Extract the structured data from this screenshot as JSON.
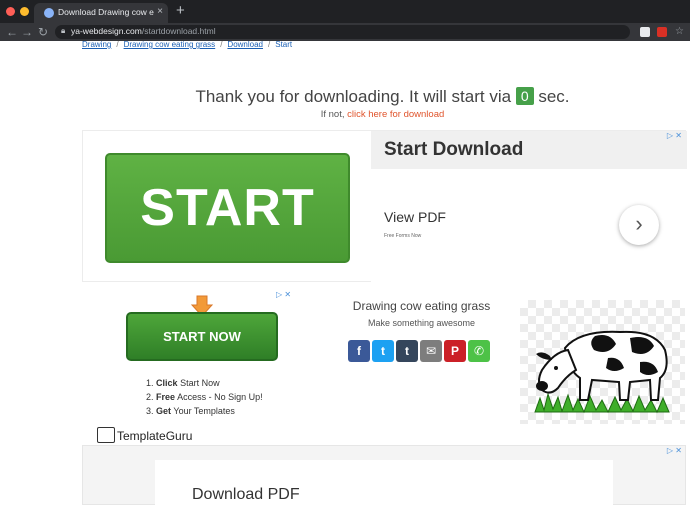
{
  "browser": {
    "tab_title": "Download Drawing cow eating",
    "tab_close": "×",
    "new_tab": "+",
    "url_host": "ya-webdesign.com",
    "url_path": "/startdownload.html",
    "back": "←",
    "forward": "→",
    "reload": "↻"
  },
  "breadcrumb": {
    "items": [
      "Drawing",
      "Drawing cow eating grass",
      "Download"
    ],
    "current": "Start",
    "separator": "/"
  },
  "download": {
    "message_prefix": "Thank you for downloading. It will start via",
    "countdown": "0",
    "message_suffix": "sec.",
    "fallback_prefix": "If not,",
    "fallback_link": "click here for download"
  },
  "ad_top": {
    "button": "START",
    "title": "Start Download",
    "view": "View PDF",
    "small": "Free Forms Now",
    "next": "›"
  },
  "ad_left": {
    "button": "START NOW",
    "steps": [
      {
        "num": "1.",
        "bold": "Click",
        "rest": "Start Now"
      },
      {
        "num": "2.",
        "bold": "Free",
        "rest": "Access - No Sign Up!"
      },
      {
        "num": "3.",
        "bold": "Get",
        "rest": "Your Templates"
      }
    ],
    "brand": "TemplateGuru"
  },
  "share": {
    "title": "Drawing cow eating grass",
    "subtitle": "Make something awesome",
    "buttons": [
      {
        "name": "facebook",
        "glyph": "f",
        "color": "#3b5998"
      },
      {
        "name": "twitter",
        "glyph": "t",
        "color": "#1da1f2"
      },
      {
        "name": "tumblr",
        "glyph": "t",
        "color": "#35465c"
      },
      {
        "name": "email",
        "glyph": "✉",
        "color": "#7d7d7d"
      },
      {
        "name": "pinterest",
        "glyph": "P",
        "color": "#cb2027"
      },
      {
        "name": "whatsapp",
        "glyph": "✆",
        "color": "#4dc247"
      }
    ]
  },
  "ad_bottom": {
    "title": "Download PDF"
  },
  "adchoice": "▷ ✕",
  "colors": {
    "accent_green": "#46a049",
    "link_blue": "#1a5fb4",
    "link_orange": "#e0542c"
  }
}
